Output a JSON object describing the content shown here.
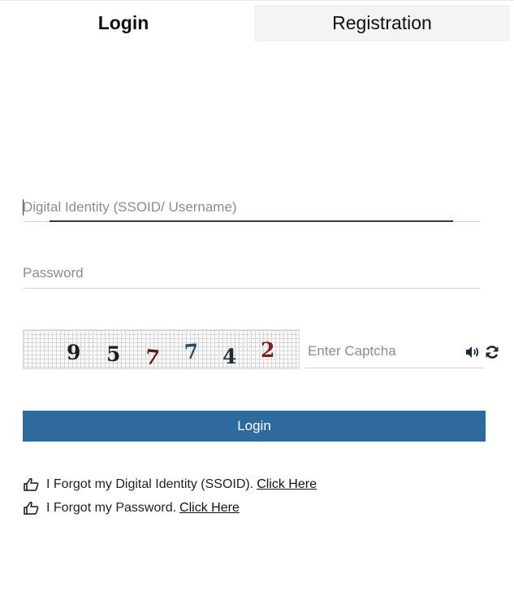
{
  "tabs": {
    "login": "Login",
    "registration": "Registration"
  },
  "form": {
    "ssoid_placeholder": "Digital Identity (SSOID/ Username)",
    "password_placeholder": "Password",
    "captcha_placeholder": "Enter Captcha",
    "captcha_digits": [
      "9",
      "5",
      "7",
      "7",
      "4",
      "2"
    ],
    "login_button": "Login"
  },
  "help": {
    "forgot_ssoid_text": "I Forgot my Digital Identity (SSOID).",
    "forgot_password_text": "I Forgot my Password.",
    "click_here": "Click Here"
  },
  "icons": {
    "audio": "speaker-icon",
    "refresh": "refresh-icon",
    "hand": "hand-pointing-icon"
  },
  "colors": {
    "login_button_bg": "#2d6a9e",
    "registration_tab_bg": "#f4f4f4",
    "focus_line": "#2a3b4c"
  }
}
